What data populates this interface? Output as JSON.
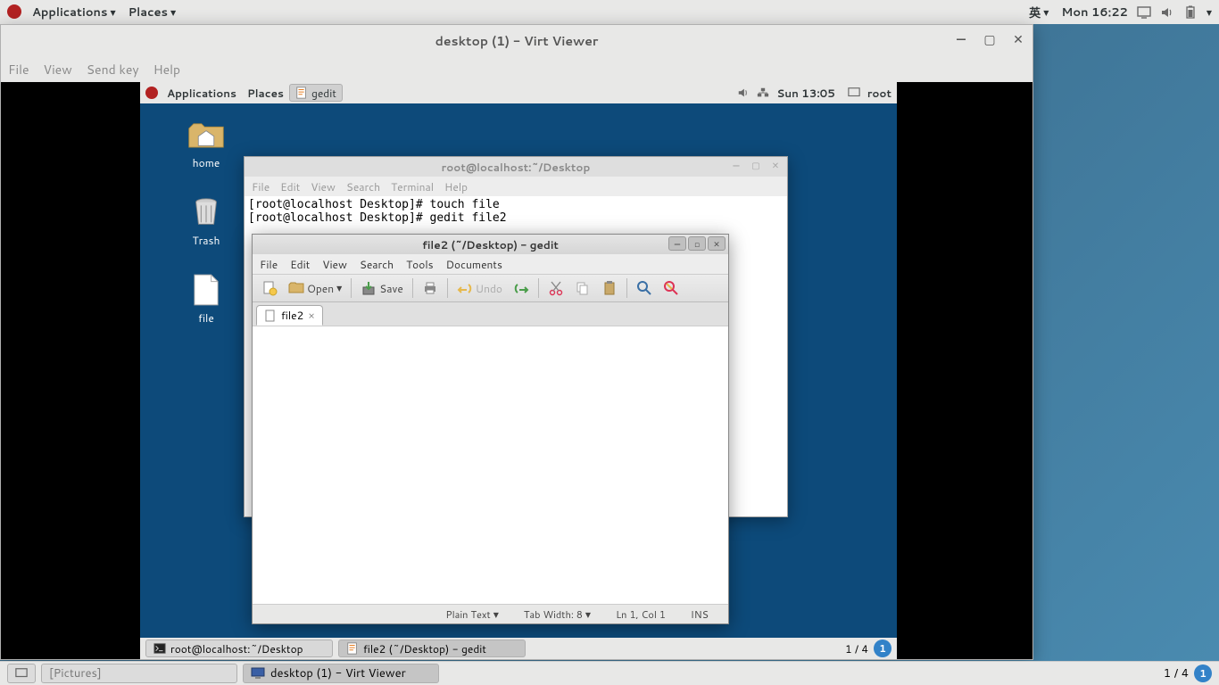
{
  "host_topbar": {
    "applications": "Applications",
    "places": "Places",
    "input_method": "英",
    "clock": "Mon 16:22"
  },
  "virtviewer": {
    "title": "desktop (1) - Virt Viewer",
    "menus": {
      "file": "File",
      "view": "View",
      "sendkey": "Send key",
      "help": "Help"
    }
  },
  "guest_topbar": {
    "applications": "Applications",
    "places": "Places",
    "task_gedit": "gedit",
    "clock": "Sun 13:05",
    "user": "root"
  },
  "guest_icons": {
    "home": "home",
    "trash": "Trash",
    "file": "file"
  },
  "terminal": {
    "title": "root@localhost:~/Desktop",
    "menus": {
      "file": "File",
      "edit": "Edit",
      "view": "View",
      "search": "Search",
      "terminal": "Terminal",
      "help": "Help"
    },
    "content": "[root@localhost Desktop]# touch file\n[root@localhost Desktop]# gedit file2\n"
  },
  "gedit": {
    "title": "file2 (~/Desktop) - gedit",
    "menus": {
      "file": "File",
      "edit": "Edit",
      "view": "View",
      "search": "Search",
      "tools": "Tools",
      "documents": "Documents"
    },
    "toolbar": {
      "open": "Open",
      "save": "Save",
      "undo": "Undo"
    },
    "tab_name": "file2",
    "status": {
      "plaintext": "Plain Text",
      "tabwidth": "Tab Width:  8",
      "lncol": "Ln 1, Col 1",
      "ins": "INS"
    }
  },
  "guest_bottombar": {
    "task_terminal": "root@localhost:~/Desktop",
    "task_gedit": "file2 (~/Desktop) - gedit",
    "workspace": "1 / 4",
    "ws_num": "1"
  },
  "host_bottombar": {
    "task_pictures": "[Pictures]",
    "task_virtviewer": "desktop (1) - Virt Viewer",
    "workspace": "1 / 4",
    "ws_num": "1"
  }
}
